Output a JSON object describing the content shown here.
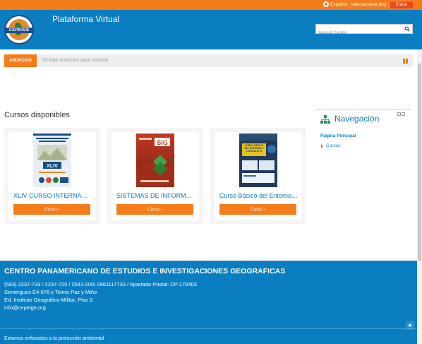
{
  "topbar": {
    "language": "Español - Internacional (es)",
    "login_label": "Entrar"
  },
  "header": {
    "logo_text": "CEPEIGE",
    "site_title": "Plataforma Virtual",
    "search_placeholder": "Buscar Cursos"
  },
  "announcements": {
    "label": "ANUNCIOS",
    "empty_text": "No hay anuncios para mostrar"
  },
  "courses": {
    "section_title": "Cursos disponibles",
    "items": [
      {
        "title": "XLIV CURSO INTERNACIONAL",
        "button_label": "Curso ›",
        "image_text": "XLIV"
      },
      {
        "title": "SISTEMAS DE INFORMACIÓN GEOGRÁFICA",
        "button_label": "Curso ›",
        "image_text": "SIG"
      },
      {
        "title": "Curso Básico del Entorno y Lenguaje R",
        "button_label": "Curso ›",
        "image_text": "CURSO BÁSICO DEL ENTORNO Y LENGUAJE R"
      }
    ]
  },
  "navigation": {
    "title": "Navegación",
    "home_label": "Página Principal",
    "courses_label": "Cursos"
  },
  "footer": {
    "org_name": "CENTRO PANAMERICANO DE ESTUDIOS E INVESTIGACIONES GEOGRAFICAS",
    "phones": "(593) 2237-733 / 2237-725 / 2541-200/ 0961117733 / Apartado Postal: CP:170403",
    "address1": "Seniergues E4-676 y Telmo Paz y Miño",
    "address2": "Ed. Instituto Geográfico Militar, Piso 3",
    "email": "info@cepeige.org",
    "tagline": "Estamos enfocados a la protección ambiental"
  },
  "colors": {
    "accent": "#f47c1a",
    "primary": "#0b7ec1",
    "login": "#e94b1b"
  },
  "icons": {
    "language": "globe-icon",
    "search": "search-icon",
    "pause": "pause-icon",
    "navigation": "sitemap-icon",
    "scroll_top": "chevron-up-icon"
  }
}
